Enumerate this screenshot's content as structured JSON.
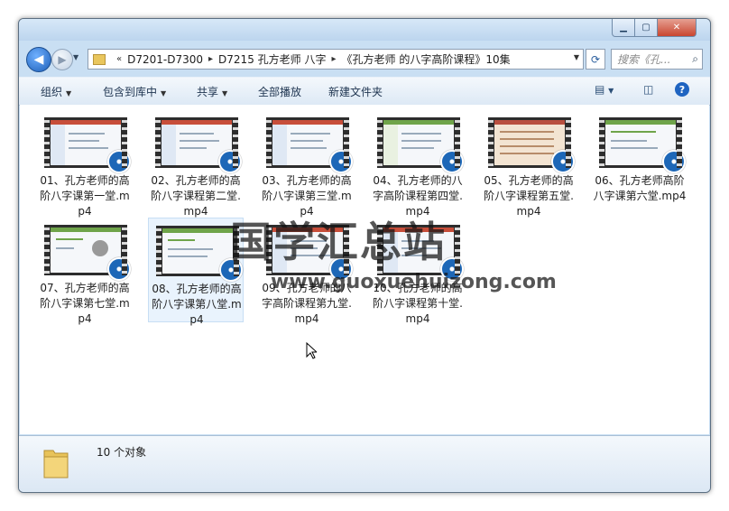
{
  "window": {
    "controls": [
      "minimize",
      "maximize",
      "close"
    ]
  },
  "address": {
    "overflow": "«",
    "crumbs": [
      "D7201-D7300",
      "D7215 孔方老师 八字",
      "《孔方老师 的八字高阶课程》10集"
    ],
    "search_placeholder": "搜索《孔..."
  },
  "toolbar": {
    "organize": "组织",
    "include_library": "包含到库中",
    "share": "共享",
    "play_all": "全部播放",
    "new_folder": "新建文件夹"
  },
  "files": [
    {
      "name": "01、孔方老师的高阶八字课第一堂.mp4",
      "style": "red"
    },
    {
      "name": "02、孔方老师的高阶八字课程第二堂.mp4",
      "style": "red"
    },
    {
      "name": "03、孔方老师的高阶八字课第三堂.mp4",
      "style": "red"
    },
    {
      "name": "04、孔方老师的八字高阶课程第四堂.mp4",
      "style": "green"
    },
    {
      "name": "05、孔方老师的高阶八字课程第五堂.mp4",
      "style": "pink"
    },
    {
      "name": "06、孔方老师高阶八字课第六堂.mp4",
      "style": "green"
    },
    {
      "name": "07、孔方老师的高阶八字课第七堂.mp4",
      "style": "green"
    },
    {
      "name": "08、孔方老师的高阶八字课第八堂.mp4",
      "style": "green"
    },
    {
      "name": "09、孔方老师的八字高阶课程第九堂.mp4",
      "style": "red"
    },
    {
      "name": "10、孔方老师的高阶八字课程第十堂.mp4",
      "style": "red"
    }
  ],
  "watermark": {
    "line1": "国学汇总站",
    "line2": "www.guoxuehuizong.com"
  },
  "status": {
    "count_text": "10 个对象"
  }
}
